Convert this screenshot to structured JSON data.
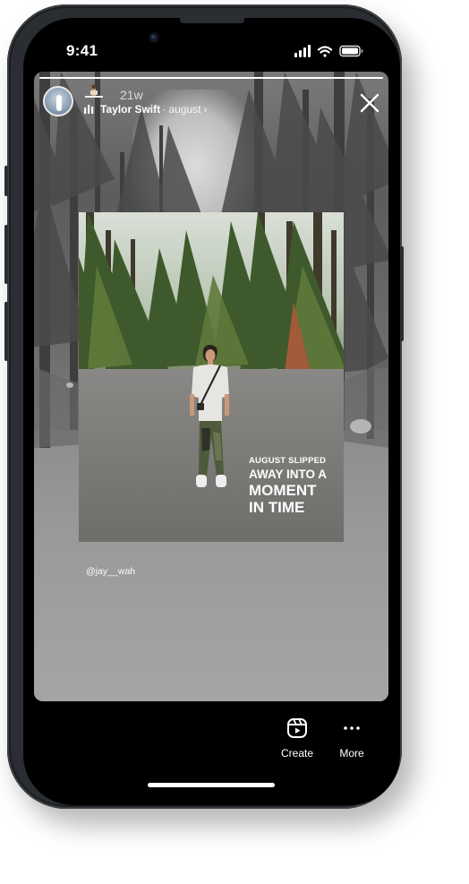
{
  "status_bar": {
    "time": "9:41"
  },
  "story": {
    "progress": 1.0,
    "time_ago": "21w",
    "artist": "Taylor Swift",
    "song": "· august",
    "chevron": "›",
    "post_caption": {
      "line1": "AUGUST SLIPPED",
      "line2": "AWAY INTO A",
      "line3": "MOMENT",
      "line4": "IN TIME"
    },
    "handle": "@jay__wah"
  },
  "bottom_bar": {
    "create_label": "Create",
    "more_label": "More"
  },
  "icons": {
    "close": "close-icon",
    "create": "reels-icon",
    "more": "more-dots-icon",
    "signal": "signal-icon",
    "wifi": "wifi-icon",
    "battery": "battery-icon"
  },
  "colors": {
    "background": "#000000",
    "text": "#ffffff"
  }
}
